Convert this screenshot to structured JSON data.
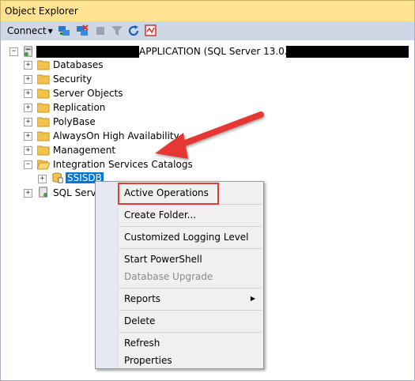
{
  "window": {
    "title": "Object Explorer"
  },
  "toolbar": {
    "connect_label": "Connect",
    "icons": [
      "connect-object-explorer-icon",
      "disconnect-icon",
      "stop-icon",
      "filter-icon",
      "refresh-icon",
      "activity-monitor-icon"
    ]
  },
  "tree": {
    "server_label": "APPLICATION (SQL Server 13.0.5264.1 -",
    "items": [
      {
        "label": "Databases"
      },
      {
        "label": "Security"
      },
      {
        "label": "Server Objects"
      },
      {
        "label": "Replication"
      },
      {
        "label": "PolyBase"
      },
      {
        "label": "AlwaysOn High Availability"
      },
      {
        "label": "Management"
      },
      {
        "label": "Integration Services Catalogs"
      }
    ],
    "ssisdb_label": "SSISDB",
    "sql_agent_label": "SQL Server"
  },
  "context_menu": {
    "items": [
      {
        "label": "Active Operations",
        "enabled": true
      },
      {
        "label": "Create Folder...",
        "enabled": true
      },
      {
        "label": "Customized Logging Level",
        "enabled": true
      },
      {
        "label": "Start PowerShell",
        "enabled": true
      },
      {
        "label": "Database Upgrade",
        "enabled": false
      },
      {
        "label": "Reports",
        "enabled": true,
        "submenu": true
      },
      {
        "label": "Delete",
        "enabled": true
      },
      {
        "label": "Refresh",
        "enabled": true
      },
      {
        "label": "Properties",
        "enabled": true
      }
    ]
  },
  "colors": {
    "title_bar": "#ffe393",
    "toolbar": "#cfd6e5",
    "selection": "#0078d7",
    "annotation": "#e53935"
  }
}
